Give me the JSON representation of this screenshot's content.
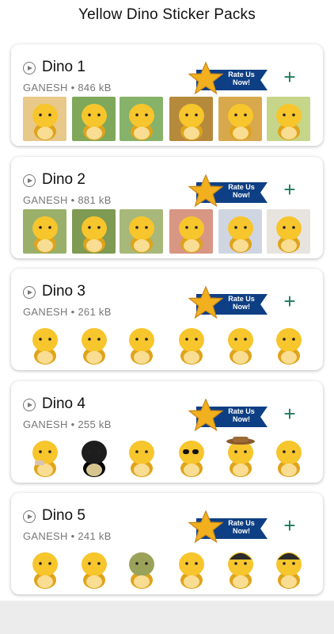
{
  "header": {
    "title": "Yellow Dino Sticker Packs"
  },
  "rate_label_line1": "Rate Us",
  "rate_label_line2": "Now!",
  "colors": {
    "accent": "#1b7a5f",
    "ribbon": "#0e3f84",
    "star": "#f2b01e",
    "dino": "#f7c52c"
  },
  "packs": [
    {
      "name": "Dino 1",
      "author": "GANESH",
      "size": "846 kB",
      "stickers": [
        "dino-doll-sticker",
        "dino-grass-sticker",
        "dino-field-sticker",
        "dino-sunflower-sticker",
        "dino-sunflower-2-sticker",
        "dino-garden-sticker"
      ]
    },
    {
      "name": "Dino 2",
      "author": "GANESH",
      "size": "881 kB",
      "stickers": [
        "dino-necklace-sticker",
        "dino-forest-sticker",
        "dino-sit-sticker",
        "dino-lying-sticker",
        "dino-back-sticker",
        "dino-stand-sticker"
      ]
    },
    {
      "name": "Dino 3",
      "author": "GANESH",
      "size": "261 kB",
      "stickers": [
        "dino-thinking-sticker",
        "dino-eating-sticker",
        "dino-pointing-sticker",
        "dino-bag-sticker",
        "dino-worried-sticker",
        "dino-paint-sticker"
      ]
    },
    {
      "name": "Dino 4",
      "author": "GANESH",
      "size": "255 kB",
      "stickers": [
        "dino-goggles-sticker",
        "dino-black-sticker",
        "dino-happy-sticker",
        "dino-sunglasses-sticker",
        "dino-hat-sticker",
        "dino-smile-sticker"
      ]
    },
    {
      "name": "Dino 5",
      "author": "GANESH",
      "size": "241 kB",
      "stickers": [
        "dino-face-sticker",
        "dino-peek-sticker",
        "dino-green-sticker",
        "dino-shy-sticker",
        "dino-helmet-sticker",
        "dino-helmet-2-sticker"
      ]
    }
  ]
}
